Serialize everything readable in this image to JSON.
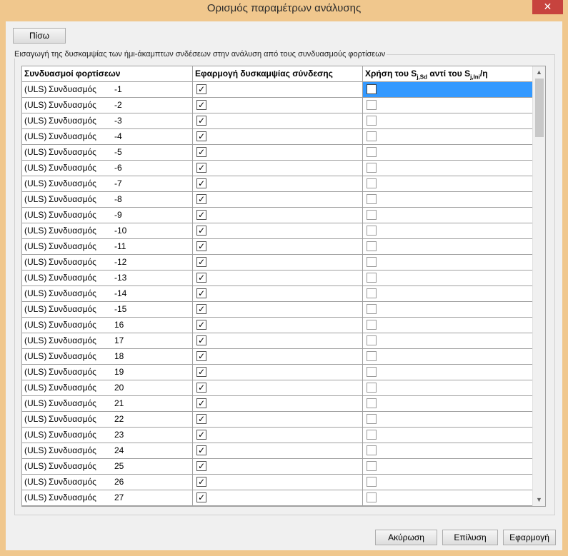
{
  "window": {
    "title": "Ορισμός παραμέτρων ανάλυσης",
    "close_label": "✕"
  },
  "toolbar": {
    "back_label": "Πίσω"
  },
  "group": {
    "label": "Εισαγωγή της δυσκαμψίας των ήμι-άκαμπτων σνδέσεων στην ανάλυση από τους συνδυασμούς φορτίσεων"
  },
  "table": {
    "col1": "Συνδυασμοί φορτίσεων",
    "col2": "Εφαρμογή δυσκαμψίας σύνδεσης",
    "col3_pre": "Χρήση του S",
    "col3_sub1": "j,Sd",
    "col3_mid": " αντί του S",
    "col3_sub2": "j,Ini",
    "col3_post": "/η",
    "rows": [
      {
        "uls": "(ULS)",
        "combo": "Συνδυασμός",
        "num": "-1",
        "apply": true,
        "use": false
      },
      {
        "uls": "(ULS)",
        "combo": "Συνδυασμός",
        "num": "-2",
        "apply": true,
        "use": false
      },
      {
        "uls": "(ULS)",
        "combo": "Συνδυασμός",
        "num": "-3",
        "apply": true,
        "use": false
      },
      {
        "uls": "(ULS)",
        "combo": "Συνδυασμός",
        "num": "-4",
        "apply": true,
        "use": false
      },
      {
        "uls": "(ULS)",
        "combo": "Συνδυασμός",
        "num": "-5",
        "apply": true,
        "use": false
      },
      {
        "uls": "(ULS)",
        "combo": "Συνδυασμός",
        "num": "-6",
        "apply": true,
        "use": false
      },
      {
        "uls": "(ULS)",
        "combo": "Συνδυασμός",
        "num": "-7",
        "apply": true,
        "use": false
      },
      {
        "uls": "(ULS)",
        "combo": "Συνδυασμός",
        "num": "-8",
        "apply": true,
        "use": false
      },
      {
        "uls": "(ULS)",
        "combo": "Συνδυασμός",
        "num": "-9",
        "apply": true,
        "use": false
      },
      {
        "uls": "(ULS)",
        "combo": "Συνδυασμός",
        "num": "-10",
        "apply": true,
        "use": false
      },
      {
        "uls": "(ULS)",
        "combo": "Συνδυασμός",
        "num": "-11",
        "apply": true,
        "use": false
      },
      {
        "uls": "(ULS)",
        "combo": "Συνδυασμός",
        "num": "-12",
        "apply": true,
        "use": false
      },
      {
        "uls": "(ULS)",
        "combo": "Συνδυασμός",
        "num": "-13",
        "apply": true,
        "use": false
      },
      {
        "uls": "(ULS)",
        "combo": "Συνδυασμός",
        "num": "-14",
        "apply": true,
        "use": false
      },
      {
        "uls": "(ULS)",
        "combo": "Συνδυασμός",
        "num": "-15",
        "apply": true,
        "use": false
      },
      {
        "uls": "(ULS)",
        "combo": "Συνδυασμός",
        "num": "16",
        "apply": true,
        "use": false
      },
      {
        "uls": "(ULS)",
        "combo": "Συνδυασμός",
        "num": "17",
        "apply": true,
        "use": false
      },
      {
        "uls": "(ULS)",
        "combo": "Συνδυασμός",
        "num": "18",
        "apply": true,
        "use": false
      },
      {
        "uls": "(ULS)",
        "combo": "Συνδυασμός",
        "num": "19",
        "apply": true,
        "use": false
      },
      {
        "uls": "(ULS)",
        "combo": "Συνδυασμός",
        "num": "20",
        "apply": true,
        "use": false
      },
      {
        "uls": "(ULS)",
        "combo": "Συνδυασμός",
        "num": "21",
        "apply": true,
        "use": false
      },
      {
        "uls": "(ULS)",
        "combo": "Συνδυασμός",
        "num": "22",
        "apply": true,
        "use": false
      },
      {
        "uls": "(ULS)",
        "combo": "Συνδυασμός",
        "num": "23",
        "apply": true,
        "use": false
      },
      {
        "uls": "(ULS)",
        "combo": "Συνδυασμός",
        "num": "24",
        "apply": true,
        "use": false
      },
      {
        "uls": "(ULS)",
        "combo": "Συνδυασμός",
        "num": "25",
        "apply": true,
        "use": false
      },
      {
        "uls": "(ULS)",
        "combo": "Συνδυασμός",
        "num": "26",
        "apply": true,
        "use": false
      },
      {
        "uls": "(ULS)",
        "combo": "Συνδυασμός",
        "num": "27",
        "apply": true,
        "use": false
      }
    ]
  },
  "footer": {
    "cancel_label": "Ακύρωση",
    "solve_label": "Επίλυση",
    "apply_label": "Εφαρμογή"
  },
  "icons": {
    "check_glyph": "✓",
    "scroll_up": "▲",
    "scroll_down": "▼"
  }
}
